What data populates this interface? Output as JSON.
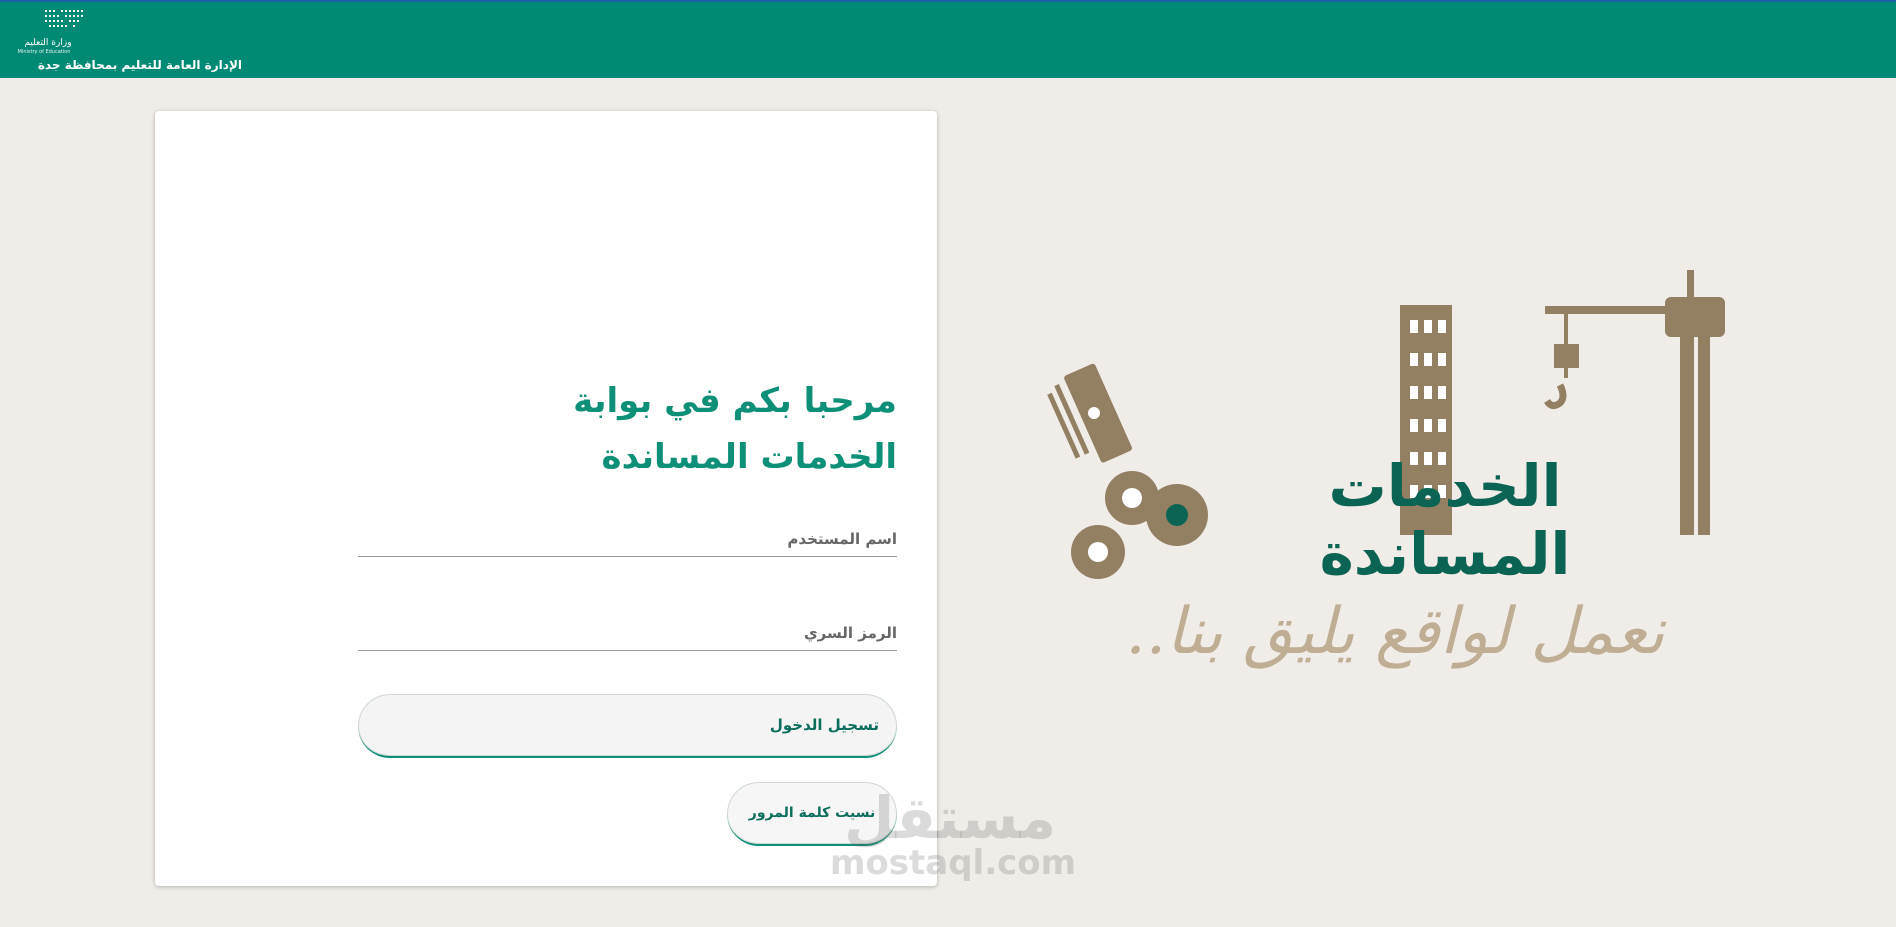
{
  "header": {
    "ministry_name_ar": "وزارة التعليم",
    "ministry_name_en": "Ministry of Education",
    "admin_title": "الإدارة العامة للتعليم بمحافظة جدة",
    "background_color": "#008a76"
  },
  "login": {
    "welcome_line1": "مرحبا بكم في بوابة",
    "welcome_line2": "الخدمات المساندة",
    "username_label": "اسم المستخدم",
    "password_label": "الرمز السري",
    "login_button": "تسجيل الدخول",
    "forgot_password": "نسيت كلمة المرور",
    "accent_color": "#0d8f78"
  },
  "branding": {
    "logo_title": "الخدمات المساندة",
    "slogan": "نعمل لواقع يليق بنا.."
  },
  "watermark": {
    "ar": "مستقل",
    "en": "mostaql.com"
  }
}
